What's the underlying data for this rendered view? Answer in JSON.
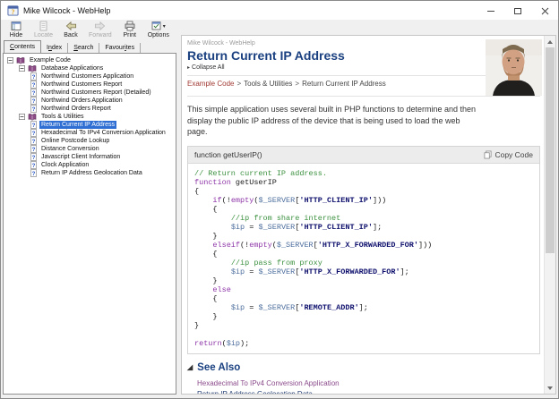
{
  "window": {
    "title": "Mike Wilcock - WebHelp"
  },
  "colors": {
    "heading_navy": "#1a4080",
    "tree_selection_blue": "#2f6fd3",
    "breadcrumb_red": "#a23b35",
    "comment_green": "#3c9140",
    "keyword_purple": "#8e36a8",
    "string_navy": "#10126e",
    "variable_slate": "#4e6f9e"
  },
  "titlebar_icons": [
    "help-app-icon",
    "minimize-icon",
    "maximize-icon",
    "close-icon"
  ],
  "toolbar": {
    "buttons": [
      {
        "label": "Hide",
        "icon": "hide-pane-icon",
        "disabled": false
      },
      {
        "label": "Locate",
        "icon": "locate-icon",
        "disabled": true
      },
      {
        "label": "Back",
        "icon": "back-arrow-icon",
        "disabled": false
      },
      {
        "label": "Forward",
        "icon": "forward-arrow-icon",
        "disabled": true
      },
      {
        "label": "Print",
        "icon": "print-icon",
        "disabled": false
      },
      {
        "label": "Options",
        "icon": "options-icon",
        "disabled": false,
        "has_dropdown": true
      }
    ]
  },
  "tabs": {
    "active_index": 0,
    "items": [
      {
        "label": "Contents",
        "underline_index": 0
      },
      {
        "label": "Index",
        "underline_index": 1
      },
      {
        "label": "Search",
        "underline_index": 0
      },
      {
        "label": "Favourites",
        "underline_index": 6
      }
    ]
  },
  "tree": {
    "items": [
      {
        "label": "Example Code",
        "level": 0,
        "icon": "book",
        "expander": "minus",
        "selected": false
      },
      {
        "label": "Database Applications",
        "level": 1,
        "icon": "book",
        "expander": "minus",
        "selected": false
      },
      {
        "label": "Northwind Customers Application",
        "level": 2,
        "icon": "page",
        "expander": null,
        "selected": false
      },
      {
        "label": "Northwind Customers Report",
        "level": 2,
        "icon": "page",
        "expander": null,
        "selected": false
      },
      {
        "label": "Northwind Customers Report (Detailed)",
        "level": 2,
        "icon": "page",
        "expander": null,
        "selected": false
      },
      {
        "label": "Northwind Orders Application",
        "level": 2,
        "icon": "page",
        "expander": null,
        "selected": false
      },
      {
        "label": "Northwind Orders Report",
        "level": 2,
        "icon": "page",
        "expander": null,
        "selected": false
      },
      {
        "label": "Tools & Utilities",
        "level": 1,
        "icon": "book",
        "expander": "minus",
        "selected": false
      },
      {
        "label": "Return Current IP Address",
        "level": 2,
        "icon": "page",
        "expander": null,
        "selected": true
      },
      {
        "label": "Hexadecimal To IPv4 Conversion Application",
        "level": 2,
        "icon": "page",
        "expander": null,
        "selected": false
      },
      {
        "label": "Online Postcode Lookup",
        "level": 2,
        "icon": "page",
        "expander": null,
        "selected": false
      },
      {
        "label": "Distance Conversion",
        "level": 2,
        "icon": "page",
        "expander": null,
        "selected": false
      },
      {
        "label": "Javascript Client Information",
        "level": 2,
        "icon": "page",
        "expander": null,
        "selected": false
      },
      {
        "label": "Clock Application",
        "level": 2,
        "icon": "page",
        "expander": null,
        "selected": false
      },
      {
        "label": "Return IP Address Geolocation Data",
        "level": 2,
        "icon": "page",
        "expander": null,
        "selected": false
      }
    ]
  },
  "content": {
    "app_title": "Mike Wilcock - WebHelp",
    "page_title": "Return Current IP Address",
    "collapse_all": "Collapse All",
    "breadcrumb": [
      "Example Code",
      "Tools & Utilities",
      "Return Current IP Address"
    ],
    "intro": "This simple application uses several built in PHP functions to determine and then display the public IP address of the device that is being used to load the web page.",
    "code_block": {
      "header": "function getUserIP()",
      "copy_label": "Copy Code",
      "copy_icon": "copy-icon",
      "lines": [
        [
          [
            "cmt",
            "// Return current IP address."
          ]
        ],
        [
          [
            "kw",
            "function"
          ],
          [
            "pl",
            " getUserIP"
          ]
        ],
        [
          [
            "pl",
            "{"
          ]
        ],
        [
          [
            "pl",
            "    "
          ],
          [
            "kw",
            "if"
          ],
          [
            "pl",
            "(!"
          ],
          [
            "kw",
            "empty"
          ],
          [
            "pl",
            "("
          ],
          [
            "var",
            "$_SERVER"
          ],
          [
            "pl",
            "["
          ],
          [
            "str",
            "'HTTP_CLIENT_IP'"
          ],
          [
            "pl",
            "]))"
          ]
        ],
        [
          [
            "pl",
            "    {"
          ]
        ],
        [
          [
            "pl",
            "        "
          ],
          [
            "cmt",
            "//ip from share internet"
          ]
        ],
        [
          [
            "pl",
            "        "
          ],
          [
            "var",
            "$ip"
          ],
          [
            "pl",
            " = "
          ],
          [
            "var",
            "$_SERVER"
          ],
          [
            "pl",
            "["
          ],
          [
            "str",
            "'HTTP_CLIENT_IP'"
          ],
          [
            "pl",
            "];"
          ]
        ],
        [
          [
            "pl",
            "    }"
          ]
        ],
        [
          [
            "pl",
            "    "
          ],
          [
            "kw",
            "elseif"
          ],
          [
            "pl",
            "(!"
          ],
          [
            "kw",
            "empty"
          ],
          [
            "pl",
            "("
          ],
          [
            "var",
            "$_SERVER"
          ],
          [
            "pl",
            "["
          ],
          [
            "str",
            "'HTTP_X_FORWARDED_FOR'"
          ],
          [
            "pl",
            "]))"
          ]
        ],
        [
          [
            "pl",
            "    {"
          ]
        ],
        [
          [
            "pl",
            "        "
          ],
          [
            "cmt",
            "//ip pass from proxy"
          ]
        ],
        [
          [
            "pl",
            "        "
          ],
          [
            "var",
            "$ip"
          ],
          [
            "pl",
            " = "
          ],
          [
            "var",
            "$_SERVER"
          ],
          [
            "pl",
            "["
          ],
          [
            "str",
            "'HTTP_X_FORWARDED_FOR'"
          ],
          [
            "pl",
            "];"
          ]
        ],
        [
          [
            "pl",
            "    }"
          ]
        ],
        [
          [
            "pl",
            "    "
          ],
          [
            "kw",
            "else"
          ]
        ],
        [
          [
            "pl",
            "    {"
          ]
        ],
        [
          [
            "pl",
            "        "
          ],
          [
            "var",
            "$ip"
          ],
          [
            "pl",
            " = "
          ],
          [
            "var",
            "$_SERVER"
          ],
          [
            "pl",
            "["
          ],
          [
            "str",
            "'REMOTE_ADDR'"
          ],
          [
            "pl",
            "];"
          ]
        ],
        [
          [
            "pl",
            "    }"
          ]
        ],
        [
          [
            "pl",
            "}"
          ]
        ],
        [],
        [
          [
            "kw",
            "return"
          ],
          [
            "pl",
            "("
          ],
          [
            "var",
            "$ip"
          ],
          [
            "pl",
            ");"
          ]
        ]
      ]
    },
    "see_also": {
      "title": "See Also",
      "links": [
        {
          "label": "Hexadecimal To IPv4 Conversion Application",
          "visited": true
        },
        {
          "label": "Return IP Address Geolocation Data",
          "visited": false
        }
      ]
    }
  }
}
